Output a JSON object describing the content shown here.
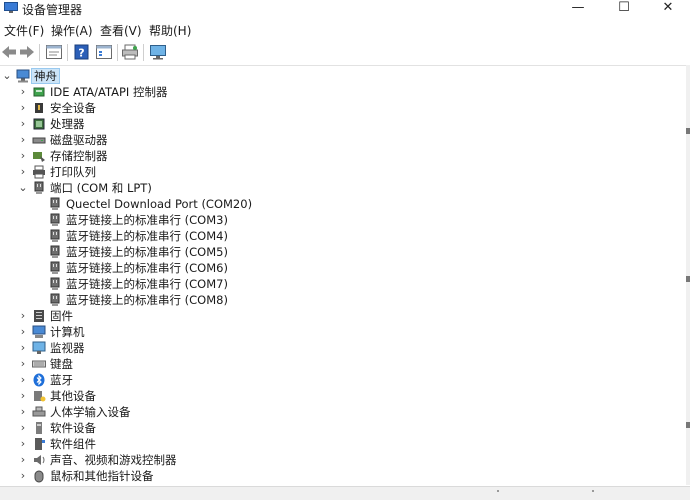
{
  "window": {
    "title": "设备管理器",
    "min_glyph": "—",
    "max_glyph": "☐",
    "close_glyph": "✕"
  },
  "menu": [
    {
      "label": "文件(F)"
    },
    {
      "label": "操作(A)"
    },
    {
      "label": "查看(V)"
    },
    {
      "label": "帮助(H)"
    }
  ],
  "toolbar": {
    "icons": [
      "back-arrow-icon",
      "forward-arrow-icon",
      "properties-icon",
      "help-icon",
      "device-list-icon",
      "print-icon",
      "monitor-icon"
    ]
  },
  "tree": {
    "root": {
      "label": "神舟",
      "expanded": true
    },
    "items": [
      {
        "label": "IDE ATA/ATAPI 控制器",
        "icon": "ide-controller-icon",
        "level": 1,
        "expander": "›"
      },
      {
        "label": "安全设备",
        "icon": "security-device-icon",
        "level": 1,
        "expander": "›"
      },
      {
        "label": "处理器",
        "icon": "processor-icon",
        "level": 1,
        "expander": "›"
      },
      {
        "label": "磁盘驱动器",
        "icon": "disk-drive-icon",
        "level": 1,
        "expander": "›"
      },
      {
        "label": "存储控制器",
        "icon": "storage-controller-icon",
        "level": 1,
        "expander": "›"
      },
      {
        "label": "打印队列",
        "icon": "printer-icon",
        "level": 1,
        "expander": "›"
      },
      {
        "label": "端口 (COM 和 LPT)",
        "icon": "port-icon",
        "level": 1,
        "expander": "⌄"
      },
      {
        "label": "Quectel Download Port (COM20)",
        "icon": "port-icon",
        "level": 2,
        "expander": ""
      },
      {
        "label": "蓝牙链接上的标准串行 (COM3)",
        "icon": "port-icon",
        "level": 2,
        "expander": ""
      },
      {
        "label": "蓝牙链接上的标准串行 (COM4)",
        "icon": "port-icon",
        "level": 2,
        "expander": ""
      },
      {
        "label": "蓝牙链接上的标准串行 (COM5)",
        "icon": "port-icon",
        "level": 2,
        "expander": ""
      },
      {
        "label": "蓝牙链接上的标准串行 (COM6)",
        "icon": "port-icon",
        "level": 2,
        "expander": ""
      },
      {
        "label": "蓝牙链接上的标准串行 (COM7)",
        "icon": "port-icon",
        "level": 2,
        "expander": ""
      },
      {
        "label": "蓝牙链接上的标准串行 (COM8)",
        "icon": "port-icon",
        "level": 2,
        "expander": ""
      },
      {
        "label": "固件",
        "icon": "firmware-icon",
        "level": 1,
        "expander": "›"
      },
      {
        "label": "计算机",
        "icon": "computer-icon",
        "level": 1,
        "expander": "›"
      },
      {
        "label": "监视器",
        "icon": "monitor-icon",
        "level": 1,
        "expander": "›"
      },
      {
        "label": "键盘",
        "icon": "keyboard-icon",
        "level": 1,
        "expander": "›"
      },
      {
        "label": "蓝牙",
        "icon": "bluetooth-icon",
        "level": 1,
        "expander": "›"
      },
      {
        "label": "其他设备",
        "icon": "other-devices-icon",
        "level": 1,
        "expander": "›"
      },
      {
        "label": "人体学输入设备",
        "icon": "hid-icon",
        "level": 1,
        "expander": "›"
      },
      {
        "label": "软件设备",
        "icon": "software-device-icon",
        "level": 1,
        "expander": "›"
      },
      {
        "label": "软件组件",
        "icon": "software-component-icon",
        "level": 1,
        "expander": "›"
      },
      {
        "label": "声音、视频和游戏控制器",
        "icon": "sound-icon",
        "level": 1,
        "expander": "›"
      },
      {
        "label": "鼠标和其他指针设备",
        "icon": "mouse-icon",
        "level": 1,
        "expander": "›"
      }
    ]
  },
  "colors": {
    "selection_bg": "#cce4f7",
    "selection_border": "#99c9ef",
    "bluetooth": "#1e6fd9"
  }
}
